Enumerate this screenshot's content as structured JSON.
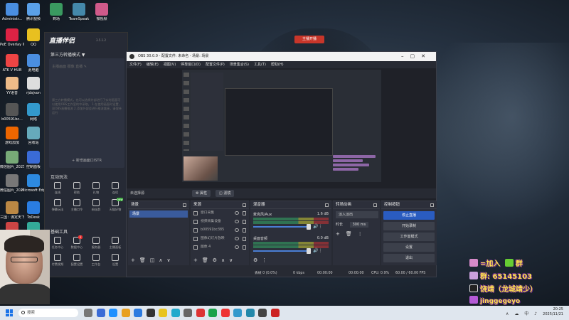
{
  "desktop_icons": [
    {
      "label": "Administr..."
    },
    {
      "label": "腾讯视频"
    },
    {
      "label": "到场"
    },
    {
      "label": "TeamSpeak"
    },
    {
      "label": "微视频"
    },
    {
      "label": "PoE Overlay II Standal..."
    },
    {
      "label": "QQ"
    },
    {
      "label": "ATK V HUB"
    },
    {
      "label": "此电脑"
    },
    {
      "label": "YY语音"
    },
    {
      "label": "rjdsjvon"
    },
    {
      "label": "b00591bc..."
    },
    {
      "label": "网络"
    },
    {
      "label": "游戏加加"
    },
    {
      "label": "回收站"
    },
    {
      "label": "微信图片_2025040..."
    },
    {
      "label": "控制面板"
    },
    {
      "label": "微信图片_2025040..."
    },
    {
      "label": "Microsoft Edge"
    },
    {
      "label": "三国：谋定天下"
    },
    {
      "label": "ToDesk"
    },
    {
      "label": "SE开启开发..."
    },
    {
      "label": "Microsoft..."
    }
  ],
  "assistant": {
    "logo": "直播伴侣",
    "version": "3.5.1.2",
    "mode": "第三方转播模式 ▼",
    "placeholder": "主播画面  摄像  直播 ✎",
    "description": "第三方转播模式，也可以选择外部进行了实时画面可以使用OBS工作室的中采取。 1.在使用画面时设置，双OBS直播推流 2.添加外部会进行推流链接，请保持运行",
    "add_label": "+ 新增画面口ISTR",
    "interact_title": "互动玩法",
    "interact": [
      "连线",
      "礼物",
      null,
      "投屏",
      null,
      "弹幕玩法",
      "主播口令",
      "如临现场",
      "外播连麦"
    ],
    "interact_row1": [
      "连线",
      "帮助",
      "礼物",
      "连续"
    ],
    "interact_row2": [
      "弹幕玩法",
      "主播口令",
      "粉丝群",
      "天猫好物"
    ],
    "tools_title": "基础工具",
    "tools_row1": [
      "任务中心",
      "数据中心",
      "服务器",
      "主播面板"
    ],
    "tools_row2": [
      "付费视频",
      "配置设置",
      "工作台",
      "设置"
    ],
    "badge_count": "1",
    "badge_new": "new"
  },
  "live_button": "主播开播",
  "obs": {
    "title": "OBS 30.0.0 - 配置文件: 未命名 - 场景: 场景",
    "menu": [
      "文件(F)",
      "编辑(E)",
      "视图(V)",
      "停靠窗口(D)",
      "配置文件(P)",
      "场景集合(S)",
      "工具(T)",
      "帮助(H)"
    ],
    "no_source": "未选择源",
    "props_btn": "⚙ 属性",
    "filters_btn": "◫ 滤镜",
    "docks": {
      "scenes": "场景",
      "sources": "来源",
      "mixer": "混音器",
      "transitions": "转场动画",
      "controls": "控制按钮"
    },
    "scenes": [
      "场景"
    ],
    "sources": [
      "窗口采集",
      "视频采集设备",
      "b00591bc385",
      "图像幻灯片放映",
      "图像 4"
    ],
    "mixer": [
      {
        "name": "麦克风/Aux",
        "db": "1.6 dB"
      },
      {
        "name": "桌面音频",
        "db": "0.0 dB"
      }
    ],
    "transition": {
      "type": "淡入淡出",
      "duration_label": "时长",
      "duration": "300 ms"
    },
    "controls": [
      "停止直播",
      "开始录制",
      "工作室模式",
      "设置",
      "退出"
    ],
    "status": {
      "dropped": "丢帧 0 (0.0%)",
      "kbps": "0 kbps",
      "stream_time": "00:00:00",
      "rec_time": "00:00:00",
      "cpu": "CPU: 0.9%",
      "fps": "60.00 / 60.00 FPS"
    }
  },
  "overlay": {
    "join": "=加入",
    "group_label": "群",
    "group_number": "群: 65145103",
    "douyin": "饶靖（龙城靖少）",
    "id": "jinggegeyo"
  },
  "taskbar": {
    "search_placeholder": "搜索",
    "time": "20:25",
    "date": "2025/11/21",
    "tray": "∧  ☁  中  ♪"
  },
  "colors": {
    "obs_blue": "#2a5cc0",
    "live_red": "#c8362a",
    "overlay_yellow": "#ffe14d"
  }
}
